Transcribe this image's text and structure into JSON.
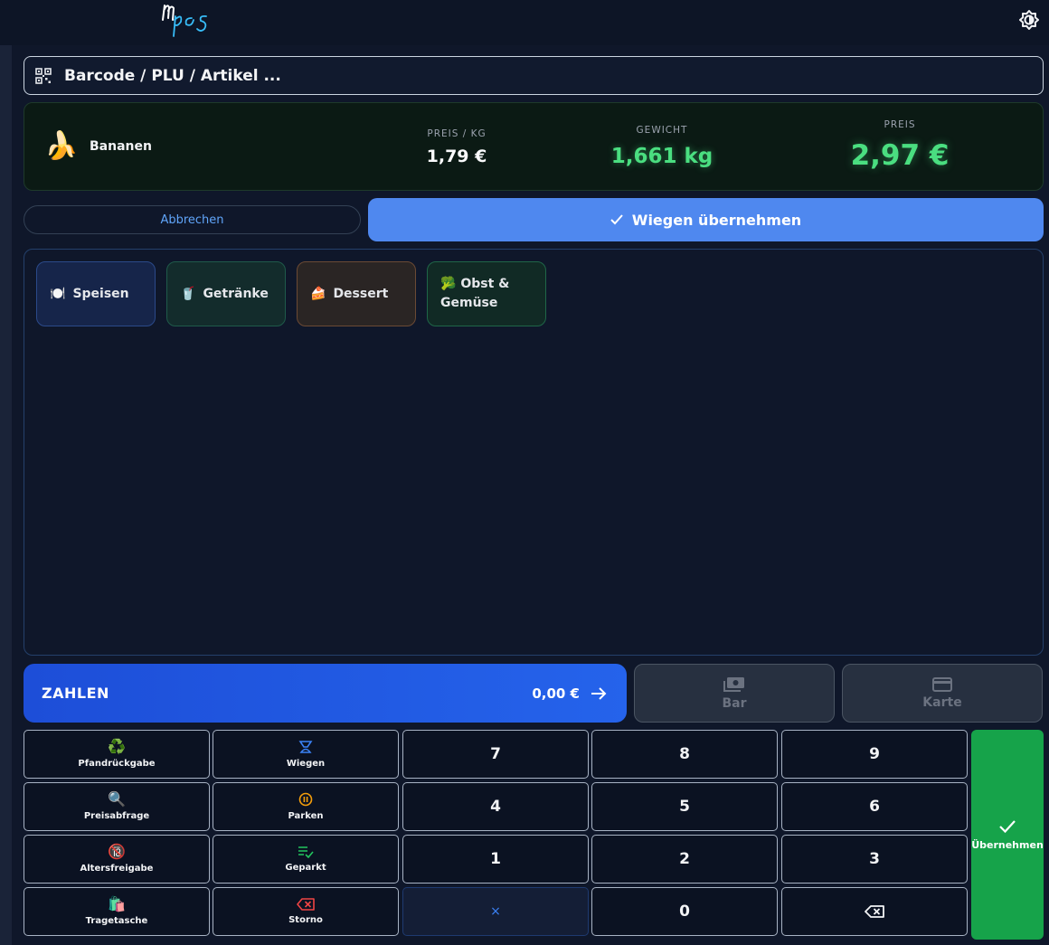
{
  "app": {
    "logo_text": "mpos"
  },
  "search": {
    "placeholder": "Barcode / PLU / Artikel ..."
  },
  "weighing": {
    "product_icon": "🍌",
    "product_name": "Bananen",
    "price_per_kg_label": "PREIS / KG",
    "price_per_kg_value": "1,79 €",
    "weight_label": "GEWICHT",
    "weight_value": "1,661 kg",
    "price_label": "PREIS",
    "price_value": "2,97 €",
    "cancel_label": "Abbrechen",
    "accept_label": "Wiegen übernehmen"
  },
  "categories": [
    {
      "icon": "🍽️",
      "label": "Speisen"
    },
    {
      "icon": "🥤",
      "label": "Getränke"
    },
    {
      "icon": "🍰",
      "label": "Dessert"
    },
    {
      "icon": "🥦",
      "label": "Obst &",
      "label2": "Gemüse"
    }
  ],
  "payment": {
    "pay_label": "ZAHLEN",
    "total": "0,00 €",
    "cash_label": "Bar",
    "card_label": "Karte"
  },
  "functions": {
    "deposit": {
      "icon": "♻️",
      "label": "Pfandrückgabe"
    },
    "weigh": {
      "icon": "⚖",
      "label": "Wiegen"
    },
    "price_check": {
      "icon": "🔍",
      "label": "Preisabfrage"
    },
    "park": {
      "icon": "⏸",
      "label": "Parken"
    },
    "age_check": {
      "icon": "🔞",
      "label": "Altersfreigabe"
    },
    "parked": {
      "icon": "≡✓",
      "label": "Geparkt"
    },
    "bag": {
      "icon": "🛍️",
      "label": "Tragetasche"
    },
    "void": {
      "icon": "⌫",
      "label": "Storno"
    }
  },
  "keypad": {
    "k7": "7",
    "k8": "8",
    "k9": "9",
    "k4": "4",
    "k5": "5",
    "k6": "6",
    "k1": "1",
    "k2": "2",
    "k3": "3",
    "clear": "×",
    "k0": "0",
    "backspace": "⌫",
    "confirm_label": "Übernehmen"
  },
  "colors": {
    "background": "#0f172a",
    "accent_blue": "#4f88ef",
    "pay_blue": "#2563eb",
    "weight_green": "#4ade80",
    "confirm_green": "#16a34a"
  }
}
